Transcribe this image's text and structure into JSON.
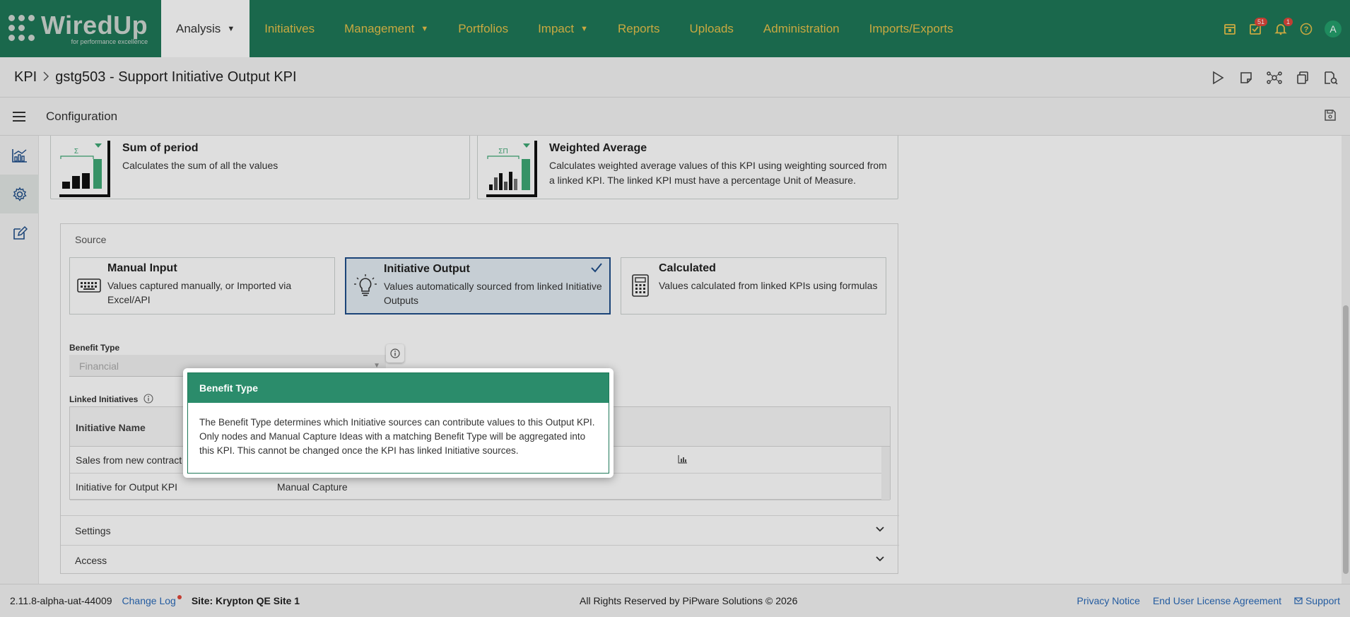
{
  "app": {
    "logo_text": "WiredUp",
    "logo_tagline": "for performance excellence"
  },
  "nav": {
    "items": [
      {
        "label": "Analysis",
        "has_caret": true,
        "active": true
      },
      {
        "label": "Initiatives"
      },
      {
        "label": "Management",
        "has_caret": true
      },
      {
        "label": "Portfolios"
      },
      {
        "label": "Impact",
        "has_caret": true
      },
      {
        "label": "Reports"
      },
      {
        "label": "Uploads"
      },
      {
        "label": "Administration"
      },
      {
        "label": "Imports/Exports"
      }
    ],
    "badges": {
      "tasks": "51",
      "notifications": "1"
    },
    "avatar_initial": "A"
  },
  "breadcrumb": {
    "root": "KPI",
    "current": "gstg503 - Support Initiative Output KPI"
  },
  "config": {
    "label": "Configuration"
  },
  "aggregation": {
    "sum": {
      "title": "Sum of period",
      "desc": "Calculates the sum of all the values"
    },
    "weighted": {
      "title": "Weighted Average",
      "desc": "Calculates weighted average values of this KPI using weighting sourced from a linked KPI. The linked KPI must have a percentage Unit of Measure."
    }
  },
  "source": {
    "title": "Source",
    "options": [
      {
        "title": "Manual Input",
        "desc": "Values captured manually, or Imported via Excel/API"
      },
      {
        "title": "Initiative Output",
        "desc": "Values automatically sourced from linked Initiative Outputs",
        "selected": true
      },
      {
        "title": "Calculated",
        "desc": "Values calculated from linked KPIs using formulas"
      }
    ],
    "benefit_type_label": "Benefit Type",
    "benefit_type_value": "Financial",
    "linked_label": "Linked Initiatives",
    "table": {
      "header": "Initiative Name",
      "rows": [
        {
          "name": "Sales from new contract",
          "type": ""
        },
        {
          "name": "Initiative for Output KPI",
          "type": "Manual Capture"
        }
      ]
    }
  },
  "accordions": {
    "settings": "Settings",
    "access": "Access"
  },
  "tooltip": {
    "title": "Benefit Type",
    "body": "The Benefit Type determines which Initiative sources can contribute values to this Output KPI. Only nodes and Manual Capture Ideas with a matching Benefit Type will be aggregated into this KPI. This cannot be changed once the KPI has linked Initiative sources."
  },
  "footer": {
    "version": "2.11.8-alpha-uat-44009",
    "changelog": "Change Log",
    "site": "Site: Krypton QE Site 1",
    "copyright": "All Rights Reserved by PiPware Solutions © 2026",
    "privacy": "Privacy Notice",
    "eula": "End User License Agreement",
    "support": "Support"
  },
  "colors": {
    "brand": "#1e7858",
    "nav_text": "#e7c24a",
    "selected_border": "#1f4f8a",
    "link": "#2a6ab8"
  }
}
